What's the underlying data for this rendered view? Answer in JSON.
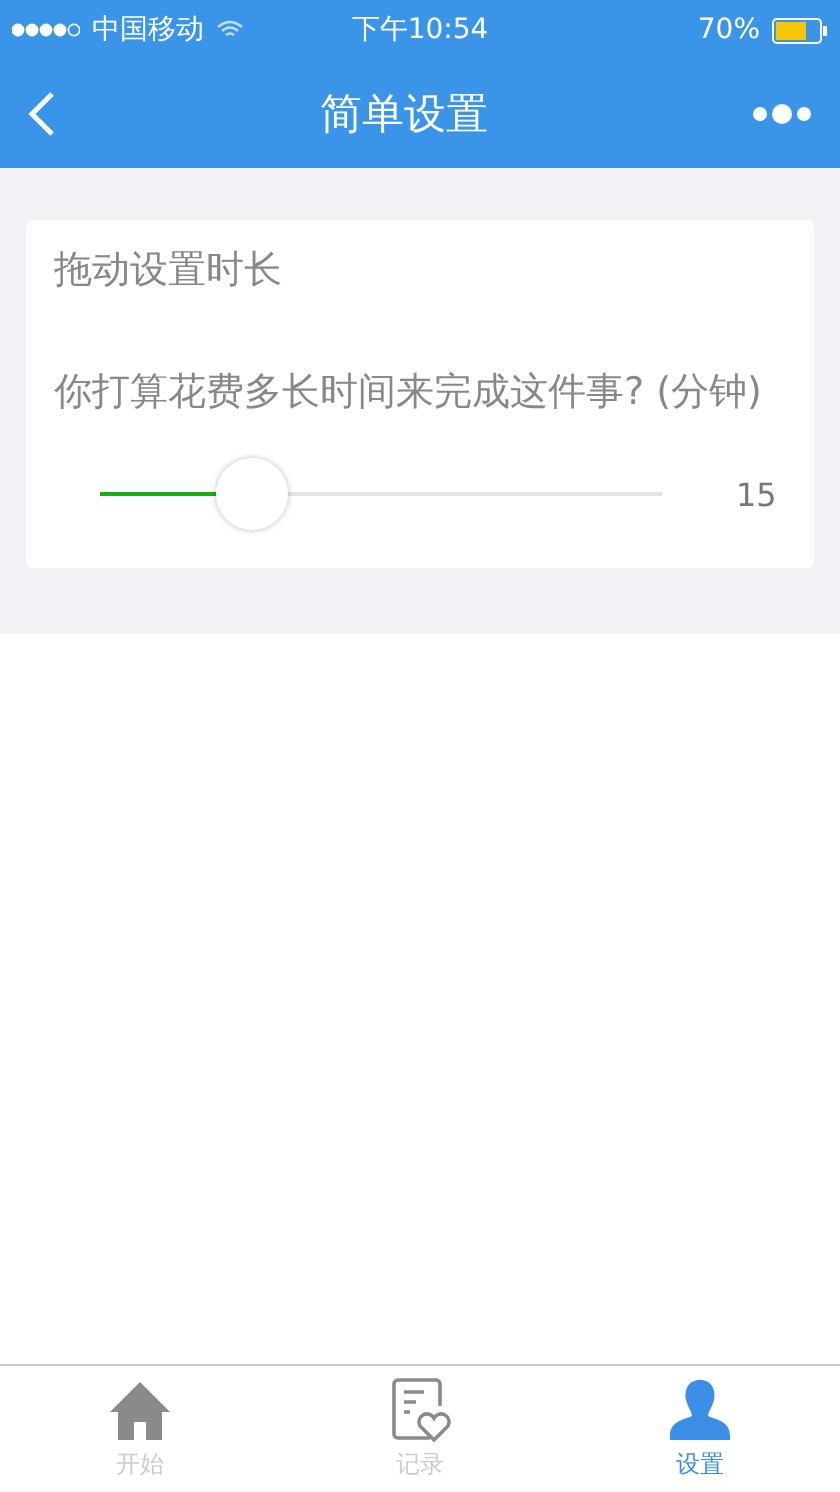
{
  "status_bar": {
    "carrier": "中国移动",
    "time": "下午10:54",
    "battery": "70%"
  },
  "nav_bar": {
    "title": "简单设置"
  },
  "card": {
    "title": "拖动设置时长",
    "question": "你打算花费多长时间来完成这件事? (分钟)",
    "slider": {
      "level": 0.24
    },
    "reading": "15"
  },
  "tab_bar": [
    {
      "label": "开始",
      "kind": "home",
      "selected": false
    },
    {
      "label": "记录",
      "kind": "record",
      "selected": false
    },
    {
      "label": "设置",
      "kind": "person",
      "selected": true
    }
  ]
}
